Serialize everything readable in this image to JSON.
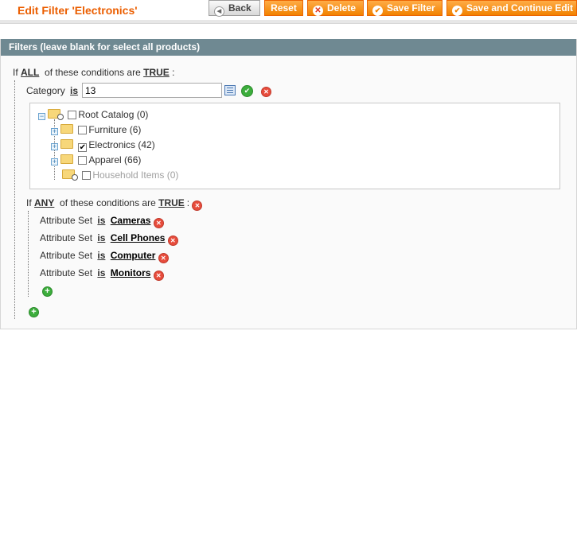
{
  "header": {
    "title": "Edit Filter 'Electronics'",
    "buttons": {
      "back": "Back",
      "reset": "Reset",
      "delete": "Delete",
      "save": "Save Filter",
      "save_continue": "Save and Continue Edit"
    }
  },
  "fieldset": {
    "legend": "Filters (leave blank for select all products)"
  },
  "conditions": {
    "root": {
      "prefix": "If",
      "aggregator": "ALL",
      "middle": "of these conditions are",
      "value": "TRUE",
      "suffix": ":"
    },
    "category": {
      "attribute": "Category",
      "operator": "is",
      "value": "13"
    },
    "tree": [
      {
        "label": "Root Catalog (0)",
        "checked": false,
        "disabled": false
      },
      {
        "label": "Furniture (6)",
        "checked": false,
        "disabled": false
      },
      {
        "label": "Electronics (42)",
        "checked": true,
        "disabled": false
      },
      {
        "label": "Apparel (66)",
        "checked": false,
        "disabled": false
      },
      {
        "label": "Household Items (0)",
        "checked": false,
        "disabled": true
      }
    ],
    "any": {
      "prefix": "If",
      "aggregator": "ANY",
      "middle": "of these conditions are",
      "value": "TRUE",
      "suffix": ":"
    },
    "attribute_sets": [
      {
        "attribute": "Attribute Set",
        "operator": "is",
        "value": "Cameras"
      },
      {
        "attribute": "Attribute Set",
        "operator": "is",
        "value": "Cell Phones"
      },
      {
        "attribute": "Attribute Set",
        "operator": "is",
        "value": "Computer"
      },
      {
        "attribute": "Attribute Set",
        "operator": "is",
        "value": "Monitors"
      }
    ]
  },
  "colors": {
    "title": "#eb5e00",
    "button": "#f18200",
    "legend_bg": "#6f8992"
  }
}
